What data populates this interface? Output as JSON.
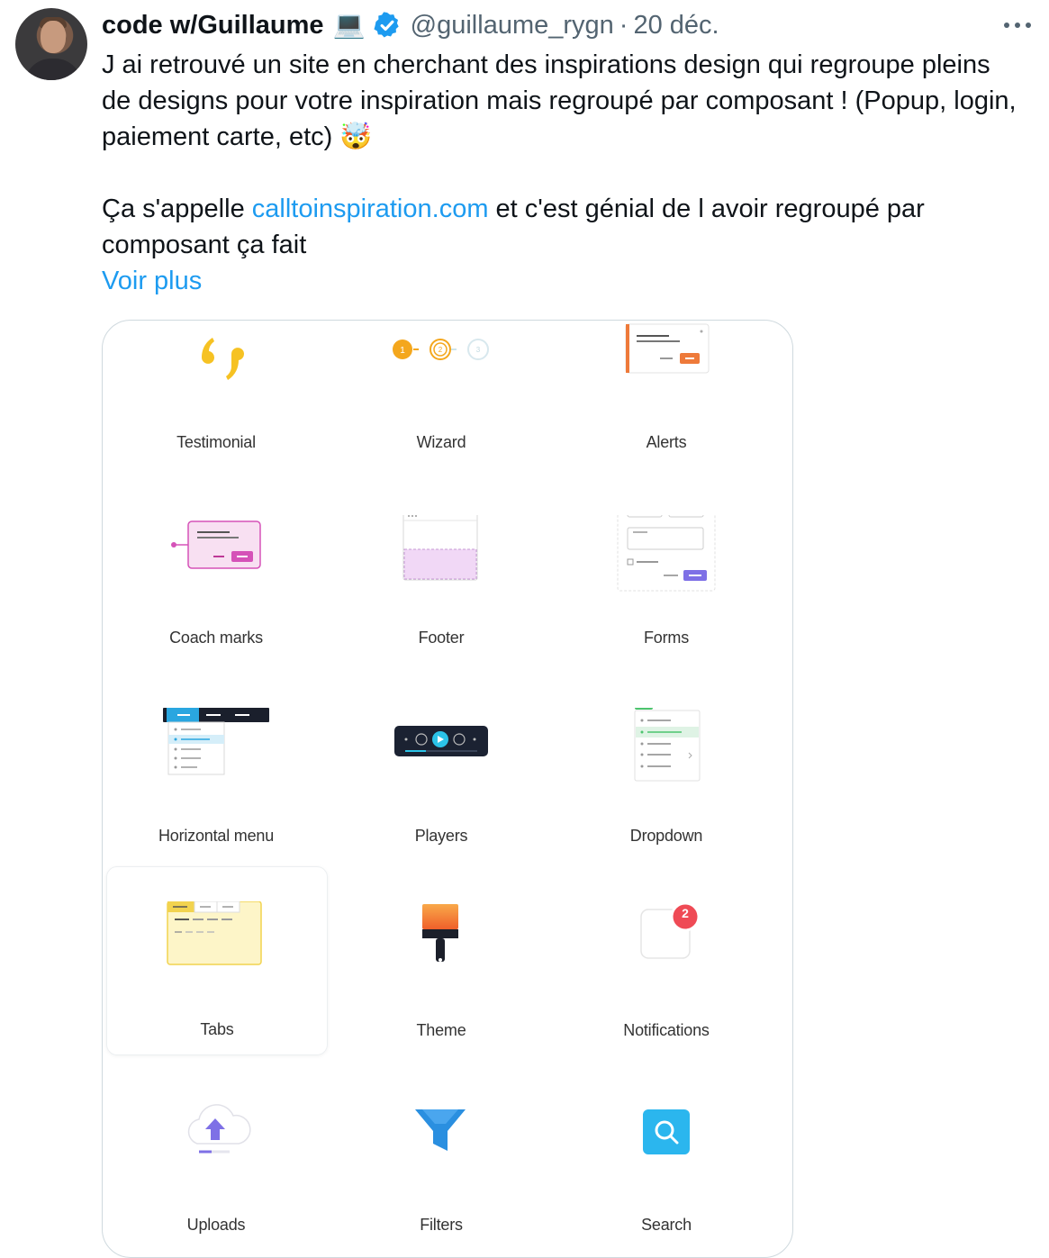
{
  "tweet": {
    "author_name": "code w/Guillaume",
    "author_emoji": "💻",
    "handle": "@guillaume_rygn",
    "separator": "·",
    "date": "20 déc.",
    "text_line1": "J ai retrouvé un site en cherchant des inspirations design qui regroupe pleins de designs pour votre inspiration mais regroupé par composant ! (Popup, login, paiement carte, etc)",
    "text_emoji": "🤯",
    "text_p2_before": "Ça s'appelle ",
    "link_text": "calltoinspiration.com",
    "text_p2_after": " et c'est génial de l avoir regroupé par composant ça fait",
    "show_more": "Voir plus"
  },
  "gallery": {
    "items": [
      {
        "label": "Testimonial",
        "icon": "testimonial-quotes-icon"
      },
      {
        "label": "Wizard",
        "icon": "wizard-steps-icon"
      },
      {
        "label": "Alerts",
        "icon": "alert-card-icon"
      },
      {
        "label": "Coach marks",
        "icon": "coach-mark-icon"
      },
      {
        "label": "Footer",
        "icon": "footer-layout-icon"
      },
      {
        "label": "Forms",
        "icon": "form-layout-icon"
      },
      {
        "label": "Horizontal menu",
        "icon": "horizontal-menu-icon"
      },
      {
        "label": "Players",
        "icon": "media-player-icon"
      },
      {
        "label": "Dropdown",
        "icon": "dropdown-list-icon"
      },
      {
        "label": "Tabs",
        "icon": "tabs-layout-icon"
      },
      {
        "label": "Theme",
        "icon": "paintbrush-icon"
      },
      {
        "label": "Notifications",
        "icon": "notification-badge-icon"
      },
      {
        "label": "Uploads",
        "icon": "cloud-upload-icon"
      },
      {
        "label": "Filters",
        "icon": "funnel-filter-icon"
      },
      {
        "label": "Search",
        "icon": "magnifier-search-icon"
      }
    ],
    "wizard_steps": [
      "1",
      "2",
      "3"
    ],
    "notification_count": "2"
  },
  "colors": {
    "link": "#1d9bf0",
    "secondary_text": "#536471",
    "verified": "#1d9bf0"
  }
}
